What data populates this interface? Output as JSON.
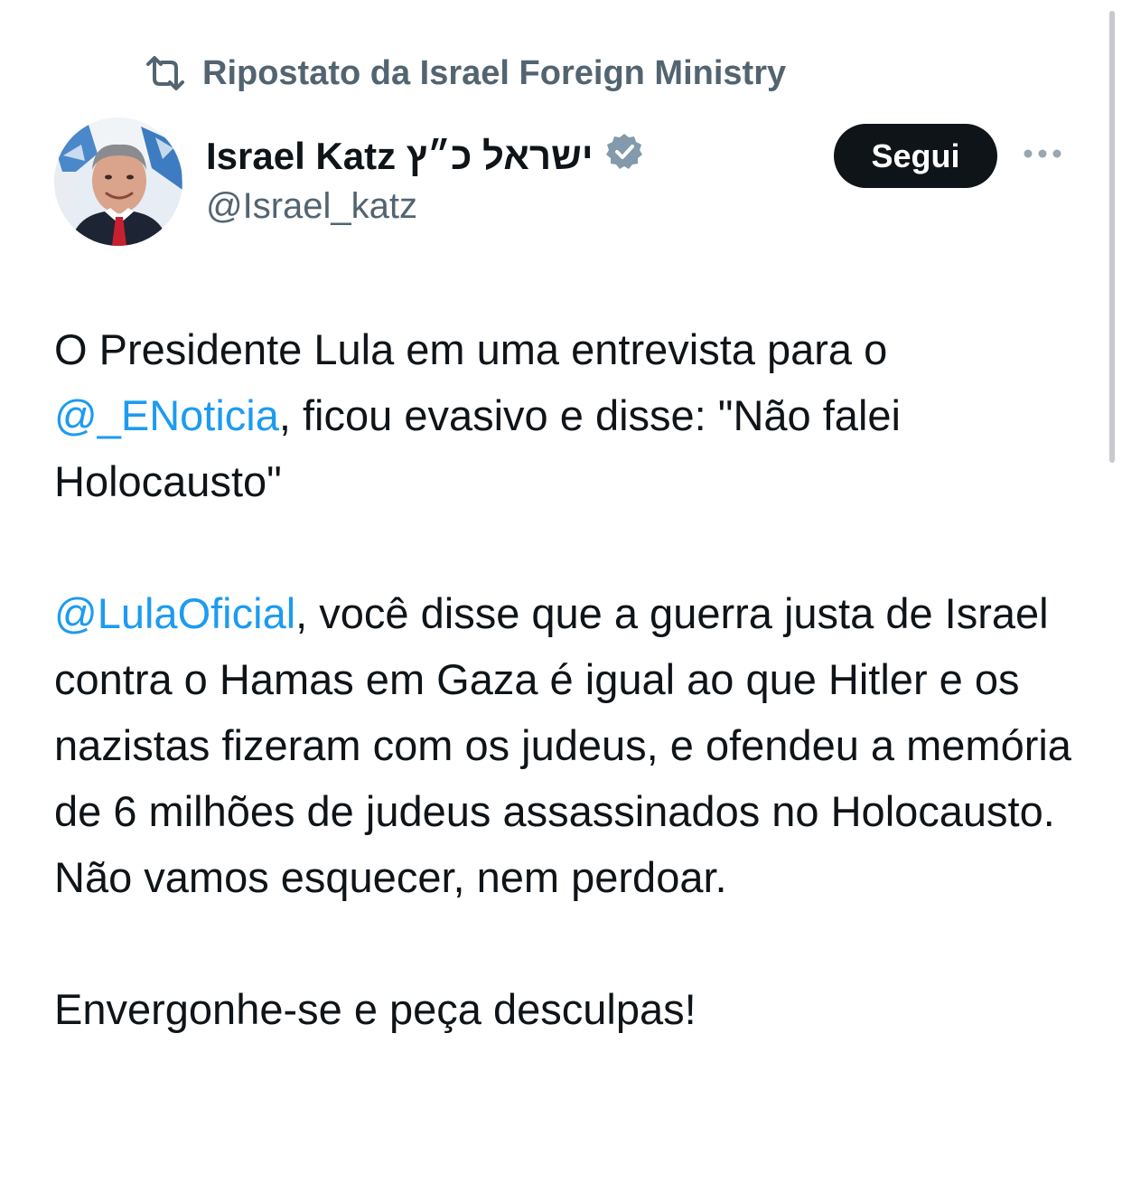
{
  "repost": {
    "icon": "repost-icon",
    "text": "Ripostato da Israel Foreign Ministry"
  },
  "author": {
    "avatar_icon": "avatar",
    "name": "Israel Katz ישראל כ״ץ",
    "verified_icon": "verified-badge-icon",
    "handle": "@Israel_katz"
  },
  "actions": {
    "follow_label": "Segui",
    "more_icon": "more-options-icon"
  },
  "tweet": {
    "p1_text_1": "O Presidente Lula em uma entrevista para o ",
    "p1_mention": "@_ENoticia",
    "p1_text_2": ", ficou evasivo e disse: \"Não falei Holocausto\"",
    "p2_mention": "@LulaOficial",
    "p2_text": ", você disse que a guerra justa de Israel contra o Hamas em Gaza é igual ao que Hitler e os nazistas fizeram com os judeus, e ofendeu a memória de 6 milhões de judeus assassinados no Holocausto. Não vamos esquecer, nem perdoar.",
    "p3_text": "Envergonhe-se e peça desculpas!"
  },
  "colors": {
    "link": "#1d9bf0",
    "secondary_text": "#536471",
    "primary_text": "#0f1419",
    "verified_badge": "#829aab"
  }
}
